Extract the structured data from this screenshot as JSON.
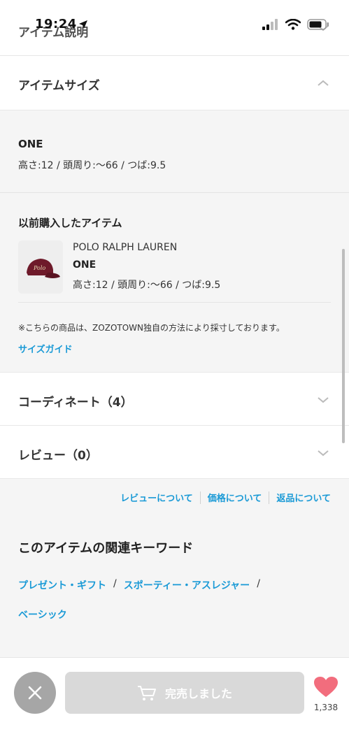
{
  "status_bar": {
    "time": "19:24"
  },
  "header": {
    "title": "アイテム説明"
  },
  "size_section": {
    "title": "アイテムサイズ",
    "size_name": "ONE",
    "size_detail": "高さ:12 / 頭周り:〜66 / つば:9.5"
  },
  "previous_purchase": {
    "title": "以前購入したアイテム",
    "brand": "POLO RALPH LAUREN",
    "size": "ONE",
    "detail": "高さ:12 / 頭周り:〜66 / つば:9.5",
    "note": "※こちらの商品は、ZOZOTOWN独自の方法により採寸しております。",
    "size_guide": "サイズガイド"
  },
  "coordinate": {
    "title": "コーディネート（4）"
  },
  "review": {
    "title": "レビュー（0）"
  },
  "links": [
    "レビューについて",
    "価格について",
    "返品について"
  ],
  "keywords": {
    "title": "このアイテムの関連キーワード",
    "items": [
      "プレゼント・ギフト",
      "スポーティー・アスレジャー",
      "ベーシック"
    ],
    "separator": "/"
  },
  "bottom_bar": {
    "soldout_label": "完売しました",
    "favorite_count": "1,338"
  },
  "colors": {
    "accent": "#1a9ad6",
    "heart": "#f26d7d",
    "disabled": "#d9d9d9"
  },
  "icons": [
    "cellular-icon",
    "wifi-icon",
    "battery-icon",
    "chevron-down-icon",
    "chevron-up-icon",
    "close-icon",
    "cart-icon",
    "heart-icon"
  ]
}
